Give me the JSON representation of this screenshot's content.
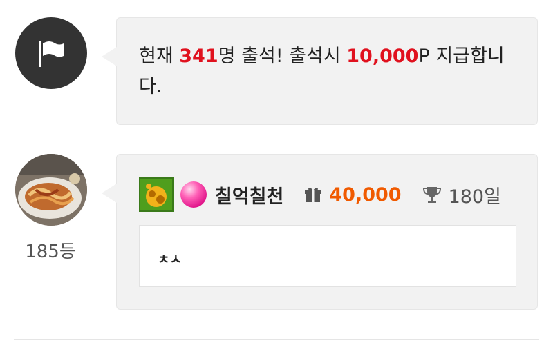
{
  "notice": {
    "prefix": "현재 ",
    "count": "341",
    "middle": "명 출석! 출석시 ",
    "points": "10,000",
    "suffix": "P 지급합니다."
  },
  "comment": {
    "nickname": "칠억칠천",
    "points": "40,000",
    "days": "180일",
    "text": "ㅊㅅ",
    "rank": "185등",
    "icons": [
      "level-badge-icon",
      "pink-orb-icon",
      "gift-icon",
      "trophy-icon",
      "flag-icon"
    ]
  },
  "colors": {
    "highlight_red": "#e0111e",
    "points_orange": "#f05a00",
    "bubble_bg": "#f2f2f2"
  }
}
